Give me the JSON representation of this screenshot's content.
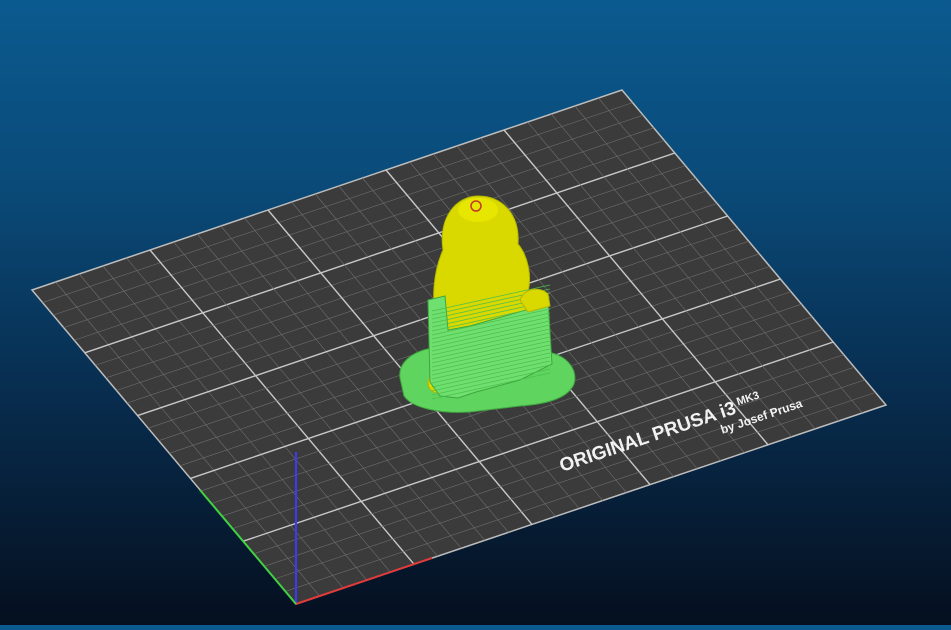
{
  "scene": {
    "background_top": "#0b5a8f",
    "background_bottom": "#050f1f"
  },
  "bed": {
    "surface_color": "#3b3b3b",
    "grid_color": "#8a8a8a",
    "logo_line1": "ORIGINAL PRUSA i3",
    "logo_model": "MK3",
    "logo_line2": "by Josef Prusa"
  },
  "axes": {
    "x_color": "#e03a3a",
    "y_color": "#3fd23f",
    "z_color": "#3a3aff"
  },
  "model": {
    "object_color": "#d9d900",
    "support_color": "#5fd45f",
    "support_edge_color": "#3fa63f"
  }
}
